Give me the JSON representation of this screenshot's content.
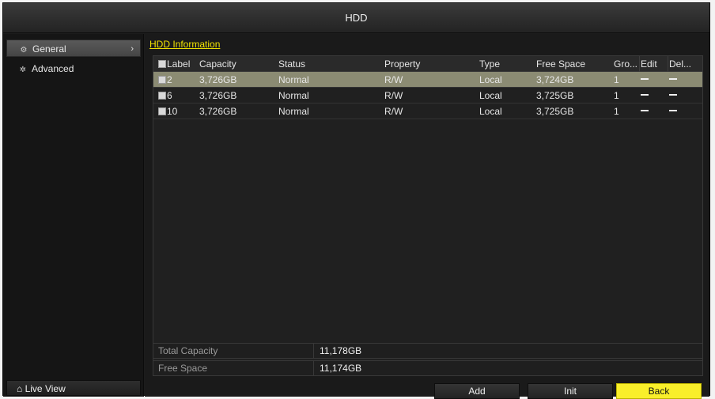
{
  "window": {
    "title": "HDD"
  },
  "sidebar": {
    "items": [
      {
        "label": "General",
        "icon": "gear-icon",
        "active": true
      },
      {
        "label": "Advanced",
        "icon": "wrench-icon",
        "active": false
      }
    ],
    "live_view": {
      "label": "Live View",
      "icon": "home-icon"
    }
  },
  "main": {
    "tab": "HDD Information",
    "table": {
      "columns": [
        "Label",
        "Capacity",
        "Status",
        "Property",
        "Type",
        "Free Space",
        "Gro...",
        "Edit",
        "Del..."
      ],
      "rows": [
        {
          "label": "2",
          "capacity": "3,726GB",
          "status": "Normal",
          "property": "R/W",
          "type": "Local",
          "free": "3,724GB",
          "group": "1",
          "edit": "—",
          "del": "—",
          "selected": true
        },
        {
          "label": "6",
          "capacity": "3,726GB",
          "status": "Normal",
          "property": "R/W",
          "type": "Local",
          "free": "3,725GB",
          "group": "1",
          "edit": "—",
          "del": "—",
          "selected": false
        },
        {
          "label": "10",
          "capacity": "3,726GB",
          "status": "Normal",
          "property": "R/W",
          "type": "Local",
          "free": "3,725GB",
          "group": "1",
          "edit": "—",
          "del": "—",
          "selected": false
        }
      ]
    },
    "summary": {
      "total_capacity_label": "Total Capacity",
      "total_capacity_value": "11,178GB",
      "free_space_label": "Free Space",
      "free_space_value": "11,174GB"
    },
    "buttons": {
      "add": "Add",
      "init": "Init",
      "back": "Back"
    }
  },
  "colors": {
    "accent": "#f9ef2a",
    "selected_row": "#8b8b73",
    "background": "#1c1c1c"
  }
}
